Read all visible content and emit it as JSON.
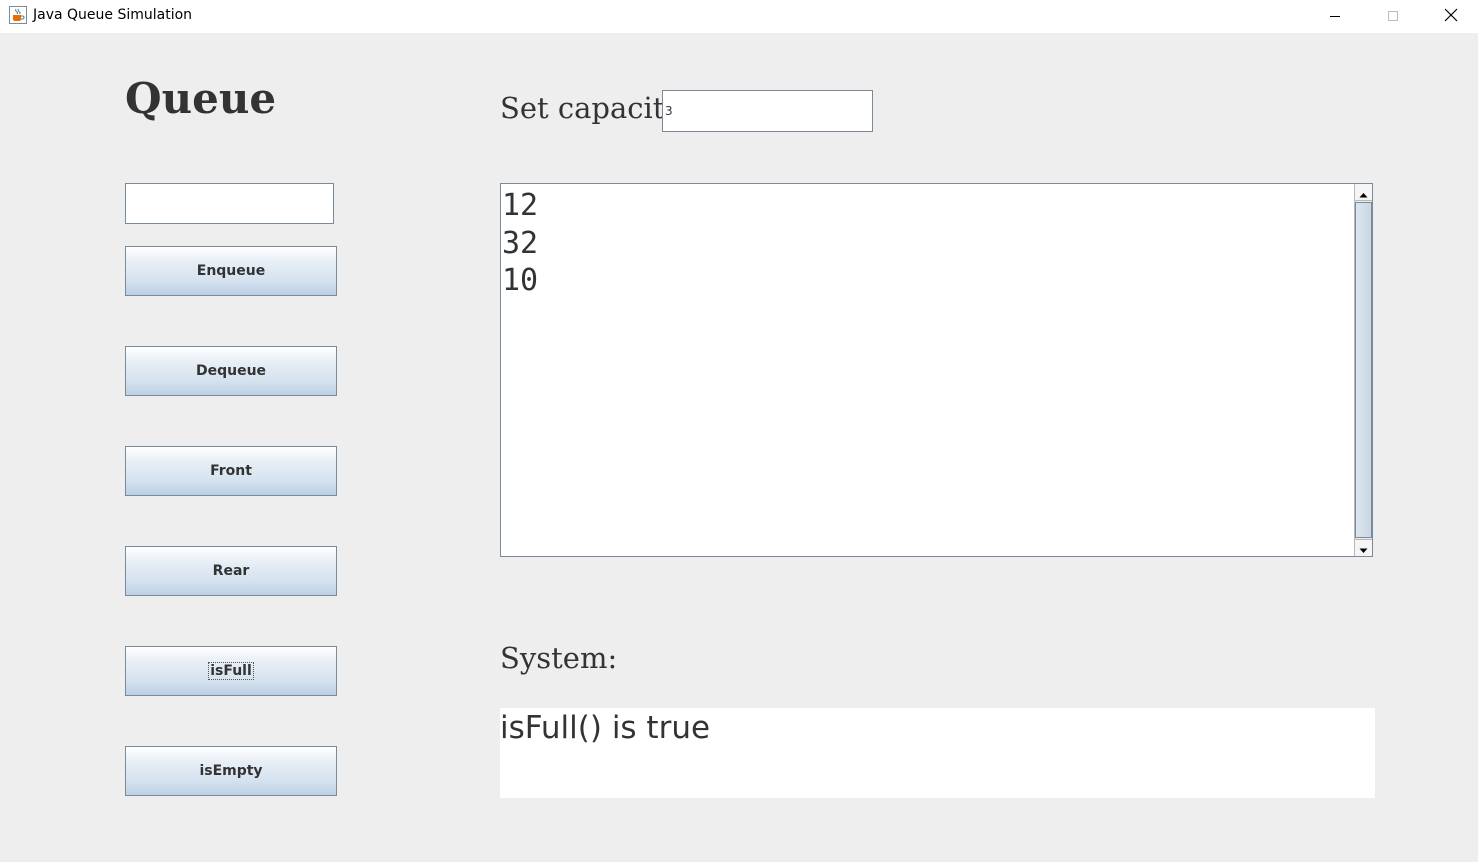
{
  "window": {
    "title": "Java Queue Simulation",
    "icon": "java-cup-icon"
  },
  "heading": "Queue",
  "value_input": {
    "value": ""
  },
  "buttons": {
    "enqueue": "Enqueue",
    "dequeue": "Dequeue",
    "front": "Front",
    "rear": "Rear",
    "isfull": "isFull",
    "isempty": "isEmpty"
  },
  "capacity": {
    "label": "Set capacity:",
    "value": "3"
  },
  "queue": {
    "items": [
      "12",
      "32",
      "10"
    ]
  },
  "system": {
    "label": "System:",
    "message": "isFull() is true"
  },
  "colors": {
    "background": "#eeeeee",
    "button_gradient_top": "#ffffff",
    "button_gradient_bottom": "#bcd0e4",
    "border": "#7a8a99",
    "text": "#333333"
  }
}
